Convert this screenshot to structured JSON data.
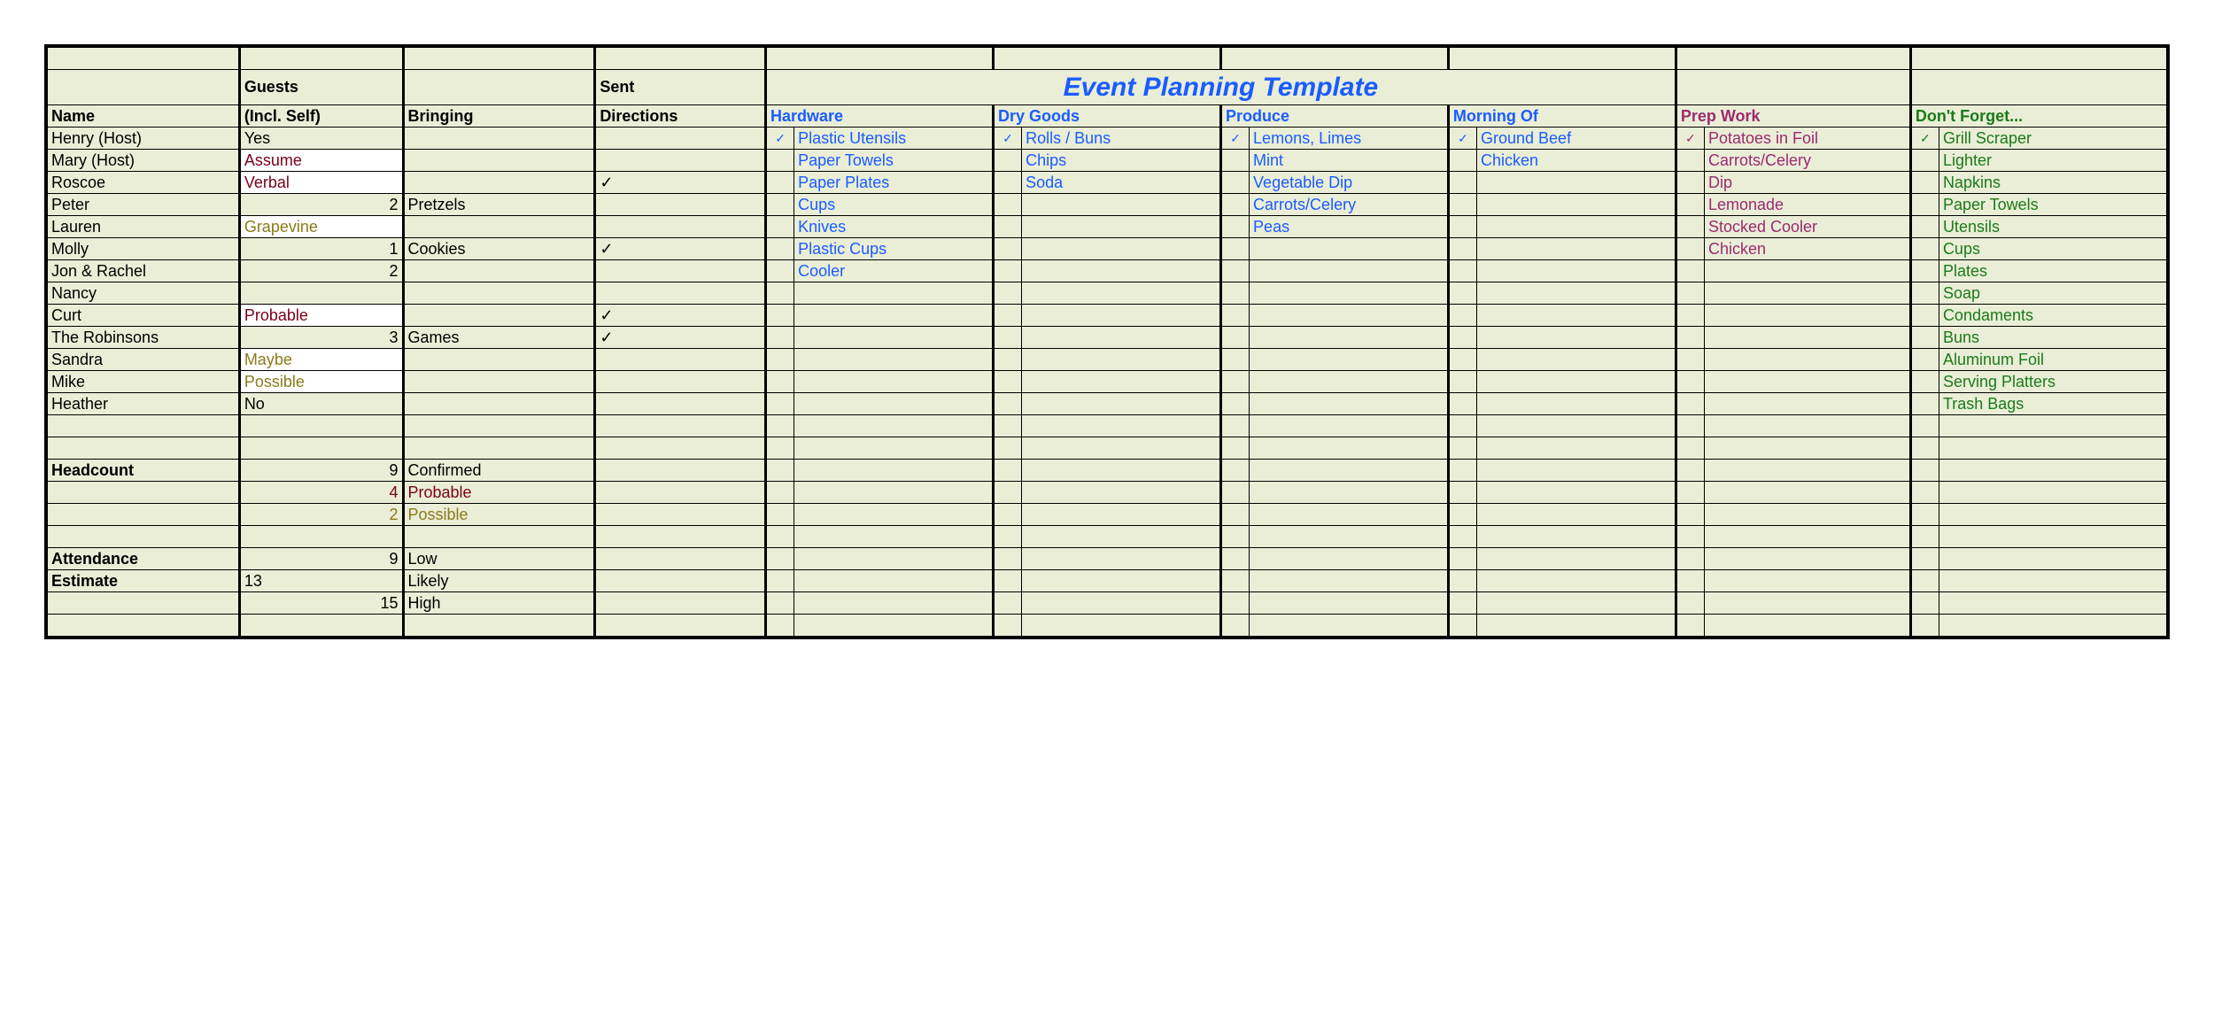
{
  "title": "Event Planning Template",
  "headers": {
    "guests": "Guests",
    "sent": "Sent",
    "name": "Name",
    "incl": "(Incl. Self)",
    "bringing": "Bringing",
    "directions": "Directions",
    "hardware": "Hardware",
    "drygoods": "Dry Goods",
    "produce": "Produce",
    "morning": "Morning Of",
    "prep": "Prep Work",
    "dontforget": "Don't Forget..."
  },
  "guests": [
    {
      "name": "Henry (Host)",
      "incl": "Yes",
      "inclStyle": "",
      "bringing": "",
      "dir": ""
    },
    {
      "name": "Mary (Host)",
      "incl": "Assume",
      "inclStyle": "maroon-w",
      "bringing": "",
      "dir": ""
    },
    {
      "name": "Roscoe",
      "incl": "Verbal",
      "inclStyle": "maroon-w",
      "bringing": "",
      "dir": "✓"
    },
    {
      "name": "Peter",
      "incl": "2",
      "inclStyle": "num",
      "bringing": "Pretzels",
      "dir": ""
    },
    {
      "name": "Lauren",
      "incl": "Grapevine",
      "inclStyle": "olive-w",
      "bringing": "",
      "dir": ""
    },
    {
      "name": "Molly",
      "incl": "1",
      "inclStyle": "num",
      "bringing": "Cookies",
      "dir": "✓"
    },
    {
      "name": "Jon & Rachel",
      "incl": "2",
      "inclStyle": "num",
      "bringing": "",
      "dir": ""
    },
    {
      "name": "Nancy",
      "incl": "",
      "inclStyle": "",
      "bringing": "",
      "dir": ""
    },
    {
      "name": "Curt",
      "incl": "Probable",
      "inclStyle": "maroon-w",
      "bringing": "",
      "dir": "✓"
    },
    {
      "name": "The Robinsons",
      "incl": "3",
      "inclStyle": "num",
      "bringing": "Games",
      "dir": "✓"
    },
    {
      "name": "Sandra",
      "incl": "Maybe",
      "inclStyle": "olive-w",
      "bringing": "",
      "dir": ""
    },
    {
      "name": "Mike",
      "incl": "Possible",
      "inclStyle": "olive-w",
      "bringing": "",
      "dir": ""
    },
    {
      "name": "Heather",
      "incl": "No",
      "inclStyle": "",
      "bringing": "",
      "dir": ""
    }
  ],
  "hardware": [
    "Plastic Utensils",
    "Paper Towels",
    "Paper Plates",
    "Cups",
    "Knives",
    "Plastic Cups",
    "Cooler"
  ],
  "drygoods": [
    "Rolls / Buns",
    "Chips",
    "Soda"
  ],
  "produce": [
    "Lemons, Limes",
    "Mint",
    "Vegetable Dip",
    "Carrots/Celery",
    "Peas"
  ],
  "morning": [
    "Ground Beef",
    "Chicken"
  ],
  "prep": [
    "Potatoes in Foil",
    "Carrots/Celery",
    "Dip",
    "Lemonade",
    "Stocked Cooler",
    "Chicken"
  ],
  "dontforget": [
    "Grill Scraper",
    "Lighter",
    "Napkins",
    "Paper Towels",
    "Utensils",
    "Cups",
    "Plates",
    "Soap",
    "Condaments",
    "Buns",
    "Aluminum Foil",
    "Serving Platters",
    "Trash Bags"
  ],
  "listChecks": {
    "hardware": "✓",
    "drygoods": "✓",
    "produce": "✓",
    "morning": "✓",
    "prep": "✓",
    "dontforget": "✓"
  },
  "summary": {
    "headcount": {
      "label": "Headcount",
      "rows": [
        {
          "n": "9",
          "style": "",
          "lbl": "Confirmed"
        },
        {
          "n": "4",
          "style": "maroon",
          "lbl": "Probable"
        },
        {
          "n": "2",
          "style": "olive",
          "lbl": "Possible"
        }
      ]
    },
    "attendance": {
      "label": "Attendance",
      "estimate": "Estimate",
      "rows": [
        {
          "n": "9",
          "pos": "right",
          "lbl": "Low"
        },
        {
          "n": "13",
          "pos": "left",
          "lbl": "Likely"
        },
        {
          "n": "15",
          "pos": "right",
          "lbl": "High"
        }
      ]
    }
  }
}
